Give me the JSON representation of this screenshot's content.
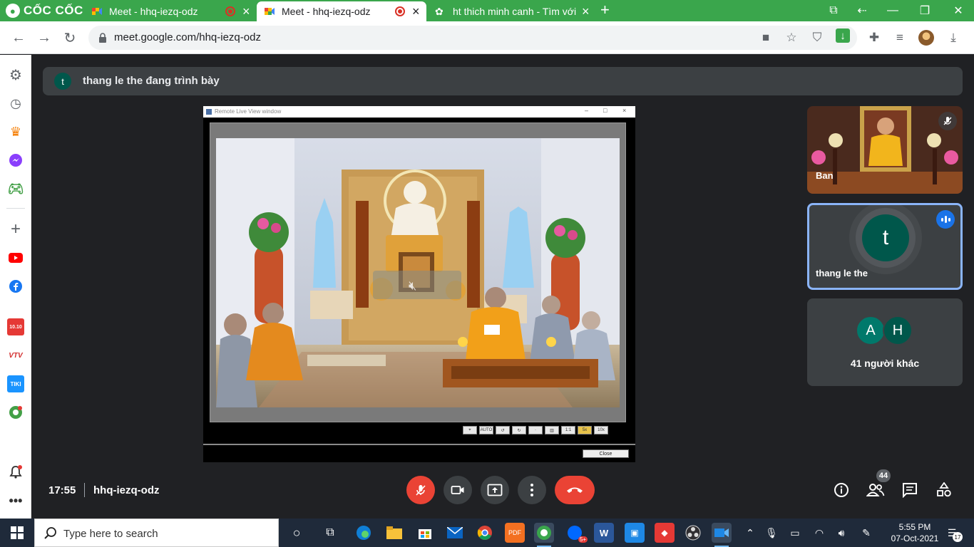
{
  "browser": {
    "brand": "CỐC CỐC",
    "tabs": [
      {
        "title": "Meet - hhq-iezq-odz",
        "recording": true
      },
      {
        "title": "Meet - hhq-iezq-odz",
        "recording": true
      },
      {
        "title": "ht thich minh canh - Tìm với"
      }
    ],
    "url": "meet.google.com/hhq-iezq-odz"
  },
  "sidebar": {
    "icons": [
      "settings-icon",
      "history-icon",
      "crown-icon",
      "messenger-icon",
      "game-icon",
      "add-icon",
      "youtube-icon",
      "facebook-icon",
      "shop-1010-icon",
      "vtv-go-icon",
      "tiki-icon",
      "soccer-icon",
      "bell-icon",
      "more-icon"
    ],
    "shop_label": "10.10",
    "vtv_label": "VTV",
    "tiki_label": "TIKI"
  },
  "meet": {
    "presenting_initial": "t",
    "presenting_banner": "thang le the đang trình bày",
    "present_window": {
      "title": "Remote Live View window",
      "close_label": "Close",
      "controls": [
        "⌖",
        "AUTO",
        "↺",
        "↻",
        "·",
        "▥",
        "1:1",
        "5x",
        "10x",
        "2"
      ]
    },
    "participants": [
      {
        "name": "Ban",
        "muted": true
      },
      {
        "name": "thang le the",
        "initial": "t",
        "speaking": true
      },
      {
        "initials": [
          "A",
          "H"
        ],
        "label": "41 người khác"
      }
    ],
    "clock": "17:55",
    "meeting_code": "hhq-iezq-odz",
    "participant_count": "44",
    "colors": {
      "accent": "#8ab4f8",
      "danger": "#ea4335",
      "avatar_t": "#00574b",
      "avatar_a": "#00796b",
      "avatar_h": "#00574b"
    }
  },
  "taskbar": {
    "search_placeholder": "Type here to search",
    "time": "5:55 PM",
    "date": "07-Oct-2021",
    "notifications": "17",
    "zalo_badge": "5+"
  }
}
